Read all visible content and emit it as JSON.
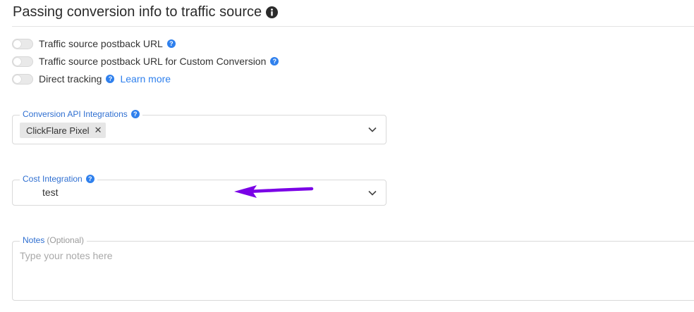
{
  "section": {
    "title": "Passing conversion info to traffic source"
  },
  "toggles": [
    {
      "label": "Traffic source postback URL",
      "enabled": false
    },
    {
      "label": "Traffic source postback URL for Custom Conversion",
      "enabled": false
    },
    {
      "label": "Direct tracking",
      "enabled": false,
      "link": "Learn more"
    }
  ],
  "conversion_api": {
    "label": "Conversion API Integrations",
    "chips": [
      "ClickFlare Pixel"
    ]
  },
  "cost_integration": {
    "label": "Cost Integration",
    "value": "test"
  },
  "notes": {
    "label": "Notes",
    "optional": "(Optional)",
    "placeholder": "Type your notes here"
  },
  "colors": {
    "accent": "#2f80ed",
    "annotation_arrow": "#7a00e6"
  }
}
